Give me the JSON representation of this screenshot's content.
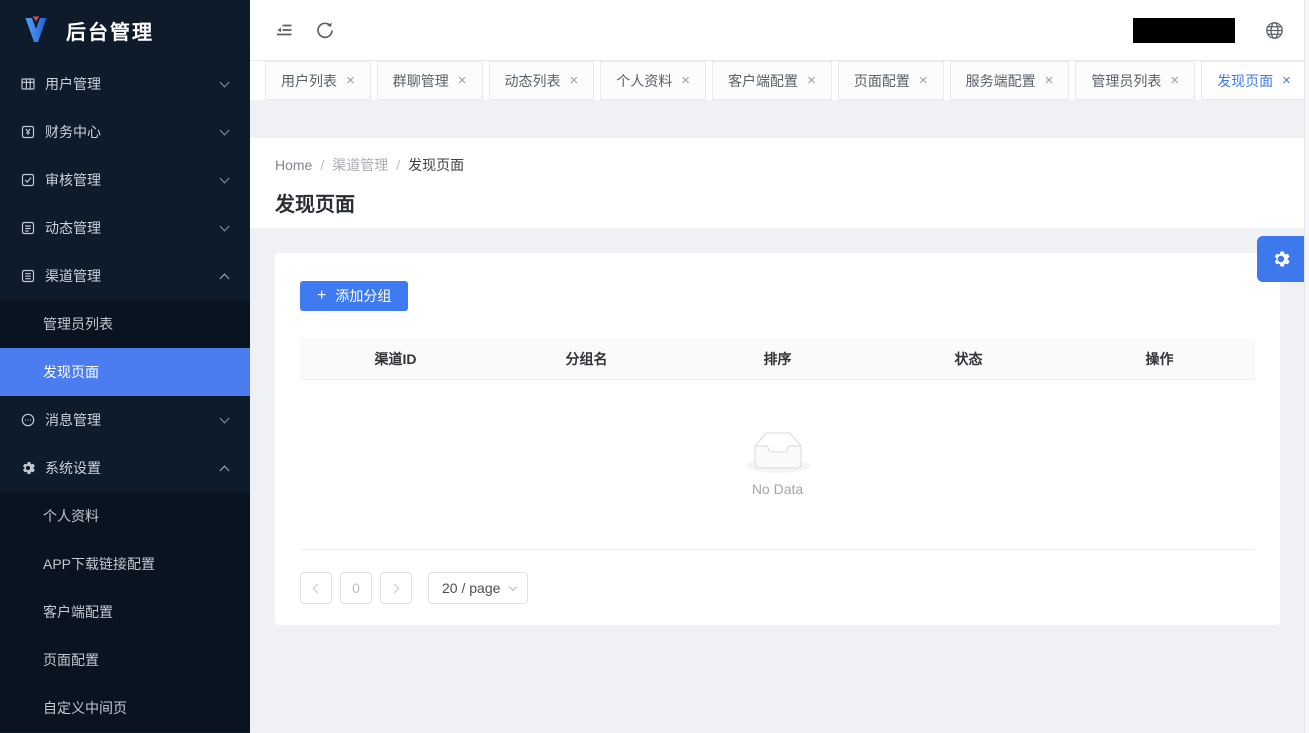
{
  "app": {
    "title": "后台管理"
  },
  "sidebar": {
    "items": [
      {
        "label": "用户管理"
      },
      {
        "label": "财务中心"
      },
      {
        "label": "审核管理"
      },
      {
        "label": "动态管理"
      },
      {
        "label": "渠道管理"
      },
      {
        "label": "管理员列表"
      },
      {
        "label": "发现页面"
      },
      {
        "label": "消息管理"
      },
      {
        "label": "系统设置"
      },
      {
        "label": "个人资料"
      },
      {
        "label": "APP下载链接配置"
      },
      {
        "label": "客户端配置"
      },
      {
        "label": "页面配置"
      },
      {
        "label": "自定义中间页"
      }
    ]
  },
  "tabs": {
    "items": [
      {
        "label": "用户列表"
      },
      {
        "label": "群聊管理"
      },
      {
        "label": "动态列表"
      },
      {
        "label": "个人资料"
      },
      {
        "label": "客户端配置"
      },
      {
        "label": "页面配置"
      },
      {
        "label": "服务端配置"
      },
      {
        "label": "管理员列表"
      },
      {
        "label": "发现页面"
      }
    ],
    "active": "发现页面"
  },
  "icons": {
    "close": "×",
    "plus": "+"
  },
  "breadcrumb": {
    "items": [
      "Home",
      "渠道管理",
      "发现页面"
    ],
    "separator": "/"
  },
  "page": {
    "title": "发现页面"
  },
  "toolbar": {
    "add_group_label": "添加分组"
  },
  "table": {
    "columns": [
      "渠道ID",
      "分组名",
      "排序",
      "状态",
      "操作"
    ],
    "empty_text": "No Data"
  },
  "pagination": {
    "current": "0",
    "page_size": "20 / page"
  },
  "colors": {
    "accent": "#3e7bf0",
    "sidebar_selected": "#4c7df0",
    "sidebar_bg": "#0e1b2b"
  }
}
